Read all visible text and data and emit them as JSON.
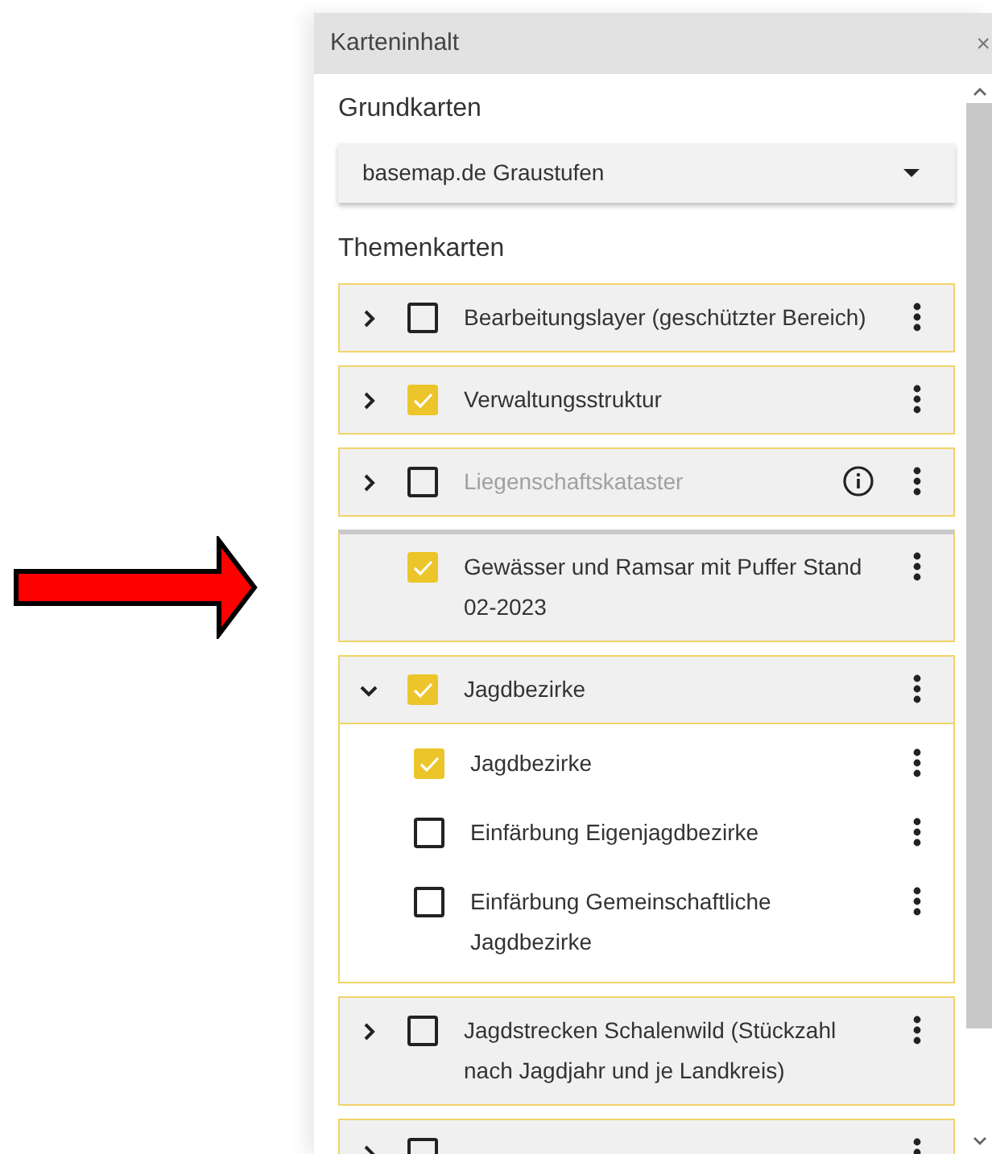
{
  "panel": {
    "title": "Karteninhalt",
    "close": "×"
  },
  "basemaps": {
    "heading": "Grundkarten",
    "selected_value": "basemap.de Graustufen"
  },
  "themes": {
    "heading": "Themenkarten",
    "layers": [
      {
        "kind": "folder",
        "label": "Bearbeitungslayer (geschützter Bereich)",
        "checked": false,
        "expanded": false
      },
      {
        "kind": "folder",
        "label": "Verwaltungsstruktur",
        "checked": true,
        "expanded": false
      },
      {
        "kind": "folder",
        "label": "Liegenschaftskataster",
        "checked": false,
        "expanded": false,
        "disabled": true,
        "info": true
      },
      {
        "kind": "layer",
        "label": "Gewässer und Ramsar mit Puffer Stand 02-2023",
        "checked": true
      },
      {
        "kind": "folder",
        "label": "Jagdbezirke",
        "checked": true,
        "expanded": true,
        "children": [
          {
            "kind": "layer",
            "label": "Jagdbezirke",
            "checked": true
          },
          {
            "kind": "layer",
            "label": "Einfärbung Eigenjagdbezirke",
            "checked": false
          },
          {
            "kind": "layer",
            "label": "Einfärbung Gemeinschaftliche Jagdbezirke",
            "checked": false
          }
        ]
      },
      {
        "kind": "folder",
        "label": "Jagdstrecken Schalenwild (Stückzahl nach Jagdjahr und je Landkreis)",
        "checked": false,
        "expanded": false
      },
      {
        "kind": "folder",
        "checked": false,
        "expanded": false
      }
    ]
  }
}
